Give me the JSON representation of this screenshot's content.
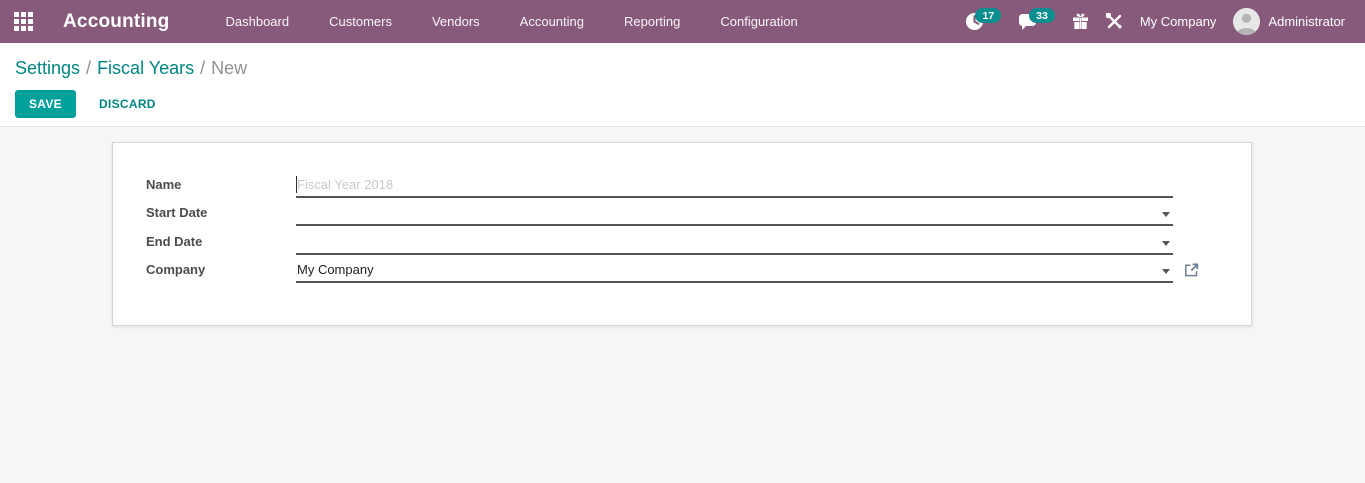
{
  "navbar": {
    "app_title": "Accounting",
    "menu": [
      "Dashboard",
      "Customers",
      "Vendors",
      "Accounting",
      "Reporting",
      "Configuration"
    ],
    "activities_count": "17",
    "messages_count": "33",
    "company": "My Company",
    "user": "Administrator",
    "icons": {
      "apps": "grid-3x3",
      "activities": "clock",
      "messages": "chat-bubble",
      "promo": "gift",
      "tools": "crossed-tools",
      "user": "avatar-silhouette"
    }
  },
  "breadcrumb": {
    "items": [
      "Settings",
      "Fiscal Years",
      "New"
    ],
    "separator": "/"
  },
  "actions": {
    "save": "SAVE",
    "discard": "DISCARD"
  },
  "form": {
    "fields": [
      {
        "label": "Name",
        "value": "",
        "placeholder": "Fiscal Year 2018"
      },
      {
        "label": "Start Date",
        "value": ""
      },
      {
        "label": "End Date",
        "value": ""
      },
      {
        "label": "Company",
        "value": "My Company"
      }
    ],
    "icons": {
      "dropdown": "caret-down",
      "open_record": "external-link"
    }
  },
  "colors": {
    "navbar_bg": "#875A7B",
    "badge": "#0d8e8e",
    "primary_button": "#00A09D",
    "link": "#008784",
    "content_bg": "#f5f6f7"
  }
}
